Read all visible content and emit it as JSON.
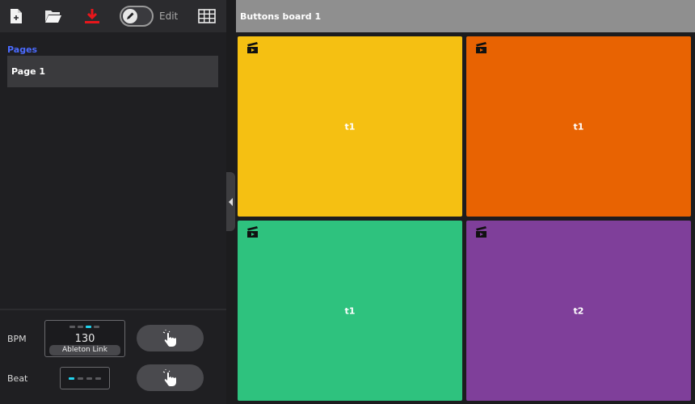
{
  "toolbar": {
    "icons": [
      "new-file-icon",
      "open-folder-icon",
      "download-icon",
      "pencil-icon",
      "grid-icon"
    ],
    "edit_label": "Edit",
    "download_color": "#e8161b"
  },
  "sidebar": {
    "pages_label": "Pages",
    "pages": [
      {
        "label": "Page 1"
      }
    ]
  },
  "tempo": {
    "bpm_label": "BPM",
    "bpm_value": "130",
    "ableton_link_label": "Ableton Link",
    "beat_label": "Beat",
    "accent": "#22d3ee"
  },
  "board": {
    "title": "Buttons board 1",
    "pads": [
      {
        "label": "t1",
        "color": "#f5c012",
        "icon": "clapperboard-icon"
      },
      {
        "label": "t1",
        "color": "#e86302",
        "icon": "clapperboard-icon"
      },
      {
        "label": "t1",
        "color": "#2ec27e",
        "icon": "clapperboard-icon"
      },
      {
        "label": "t2",
        "color": "#7f3f9a",
        "icon": "clapperboard-icon"
      }
    ]
  }
}
